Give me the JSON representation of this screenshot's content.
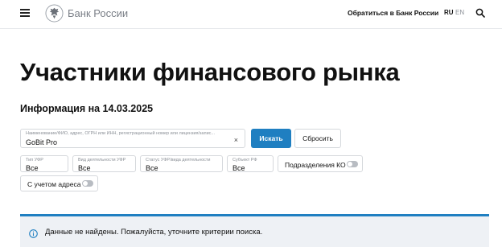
{
  "header": {
    "brand": "Банк России",
    "contact_link": "Обратиться в Банк России",
    "lang_active": "RU",
    "lang_other": "EN",
    "icons": [
      "menu-icon",
      "eagle-logo-icon",
      "search-icon"
    ]
  },
  "main": {
    "title": "Участники финансового рынка",
    "subtitle": "Информация на 14.03.2025"
  },
  "search": {
    "label": "Наименование/ФИО, адрес, ОГРН или ИНН, регистрационный номер или лицензия/запис...",
    "value": "GoBit Pro",
    "clear_label": "×",
    "submit_label": "Искать",
    "reset_label": "Сбросить"
  },
  "filters": [
    {
      "label": "Тип УФР",
      "value": "Все"
    },
    {
      "label": "Вид деятельности УФР",
      "value": "Все"
    },
    {
      "label": "Статус УФР/вида деятельности",
      "value": "Все"
    },
    {
      "label": "Субъект РФ",
      "value": "Все"
    }
  ],
  "toggles": [
    {
      "label": "Подразделения КО",
      "on": false
    },
    {
      "label": "С учетом адреса",
      "on": false
    }
  ],
  "notice": {
    "text": "Данные не найдены. Пожалуйста, уточните критерии поиска.",
    "icon": "info-icon"
  },
  "colors": {
    "accent": "#1f7fc1",
    "notice_bg": "#eef1f5",
    "muted_text": "#7a7f87"
  }
}
